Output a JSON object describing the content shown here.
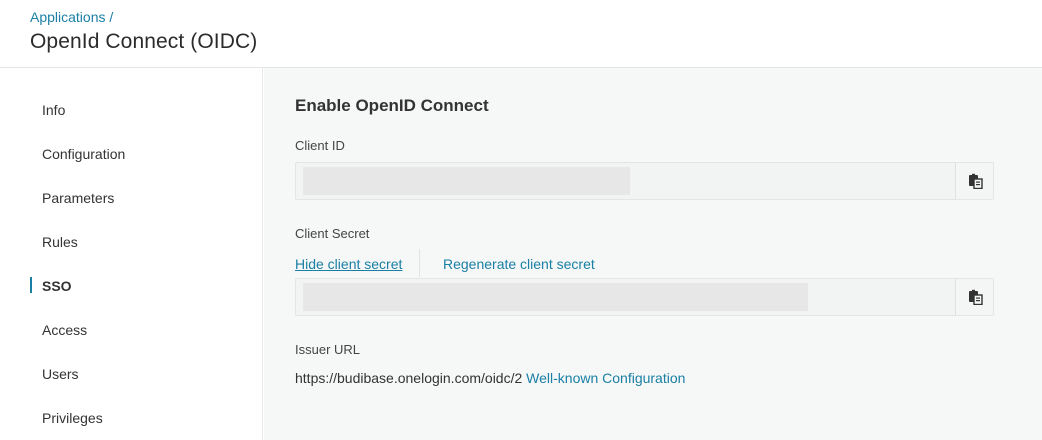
{
  "header": {
    "breadcrumb": "Applications /",
    "title": "OpenId Connect (OIDC)"
  },
  "sidebar": {
    "items": [
      {
        "label": "Info"
      },
      {
        "label": "Configuration"
      },
      {
        "label": "Parameters"
      },
      {
        "label": "Rules"
      },
      {
        "label": "SSO",
        "active": true
      },
      {
        "label": "Access"
      },
      {
        "label": "Users"
      },
      {
        "label": "Privileges"
      }
    ]
  },
  "main": {
    "section_title": "Enable OpenID Connect",
    "client_id": {
      "label": "Client ID",
      "copy_icon": "clipboard-icon"
    },
    "client_secret": {
      "label": "Client Secret",
      "hide_link": "Hide client secret",
      "regenerate_link": "Regenerate client secret",
      "copy_icon": "clipboard-icon"
    },
    "issuer": {
      "label": "Issuer URL",
      "url": "https://budibase.onelogin.com/oidc/2",
      "well_known_link": "Well-known Configuration"
    }
  },
  "colors": {
    "accent": "#1a7fa5",
    "main_bg": "#f6f7f7",
    "text": "#333333"
  }
}
